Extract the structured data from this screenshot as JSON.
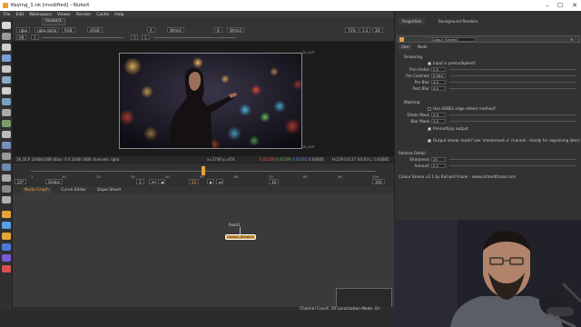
{
  "window": {
    "title": "Keying_1.nk [modified] - NukeX",
    "min": "–",
    "max": "☐",
    "close": "✕"
  },
  "menu": [
    "File",
    "Edit",
    "Workspace",
    "Viewer",
    "Render",
    "Cache",
    "Help"
  ],
  "viewer": {
    "tab": "Viewer1",
    "row1": {
      "channels": "rgba",
      "alpha": "rgba.alpha",
      "colorspace": "RGB",
      "lut": "sRGB",
      "input_a": "A",
      "input_b": "Write2",
      "input_b2": "B",
      "input_b3": "Write3",
      "zoom": "75%",
      "ratio": "1:1",
      "mode": "3D"
    },
    "row2": {
      "fstop": "f/8",
      "gain": "1",
      "y_label": "Y",
      "gamma": "1"
    },
    "format_top": "2K_DCP",
    "format_bottom": "2K_DCP",
    "status": {
      "info": "2K_DCP 2048x1080  bbox: 0 0 2048 1080 channels: rgba",
      "coords": "x=1746 y=474",
      "r": "0.02266",
      "g": "0.02789",
      "b": "0.03361",
      "a": "0.00000",
      "hsv": "H:219 S:0.27 V:0.03  L: 0.02685"
    }
  },
  "timeline": {
    "fps": "24*",
    "global": "Global",
    "frame_start": "1",
    "frame_end": "100",
    "current_frame": "50",
    "step": "10",
    "ticks": [
      "1",
      "10",
      "20",
      "30",
      "40",
      "50",
      "60",
      "70",
      "80",
      "90",
      "100"
    ]
  },
  "panels": {
    "tabs": [
      "Node Graph",
      "Curve Editor",
      "Dope Sheet"
    ]
  },
  "nodes": {
    "read_label": "Read1",
    "node_label": "Colour_Smear1"
  },
  "bottom": {
    "status": "Channel Count: 20  Localization Mode: On"
  },
  "properties": {
    "tabs": [
      "Properties",
      "Background Renders"
    ],
    "node_name": "Colour_Smear1",
    "subtabs": [
      "User",
      "Node"
    ],
    "sections": {
      "smearing": "Smearing",
      "masking": "Masking",
      "restore": "Restore Detail"
    },
    "premult_label": "Input is premultiplied?",
    "fields": [
      {
        "label": "Pre-chokie",
        "value": "2.0"
      },
      {
        "label": "Pre Contrast",
        "value": "0.094"
      },
      {
        "label": "Pre Blur",
        "value": "4.0"
      },
      {
        "label": "Post Blur",
        "value": "0.0"
      }
    ],
    "sobel_label": "Use SOBEL edge detect method?",
    "mask_fields": [
      {
        "label": "Dilate Mask",
        "value": "2.0"
      },
      {
        "label": "Blur Mask",
        "value": "3.0"
      }
    ],
    "premult_output": "Premultiply output",
    "output_mask": "Output smear mask? see 'smearmask.a' channel - handy for regraining later)",
    "restore_fields": [
      {
        "label": "Sharpness",
        "value": "10"
      },
      {
        "label": "Amount",
        "value": "0.1"
      }
    ],
    "footer": "Colour Smear v2.1 by Richard Frazer - www.richardfrazer.com"
  },
  "colors": {
    "accent": "#e8a33a",
    "node": "#d9a14a",
    "red": "#e85050",
    "green": "#55c055",
    "blue": "#5a8fe8"
  }
}
